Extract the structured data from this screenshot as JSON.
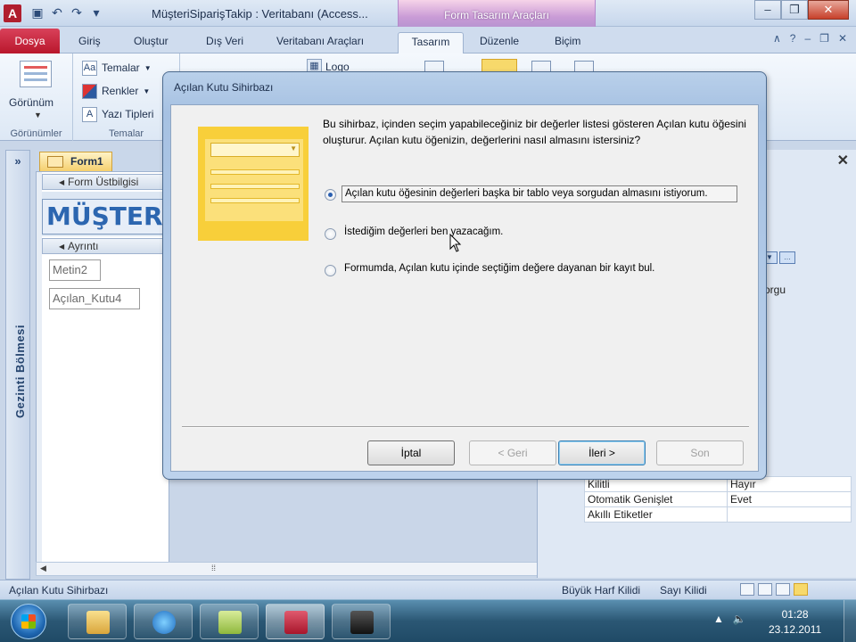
{
  "titlebar": {
    "app_letter": "A",
    "title": "MüşteriSiparişTakip : Veritabanı (Access...",
    "context_group": "Form Tasarım Araçları"
  },
  "tabs": [
    "Dosya",
    "Giriş",
    "Oluştur",
    "Dış Veri",
    "Veritabanı Araçları",
    "Tasarım",
    "Düzenle",
    "Biçim"
  ],
  "ribbon": {
    "view_label": "Görünüm",
    "views_group": "Görünümler",
    "themes_group": "Temalar",
    "themes": "Temalar",
    "colors": "Renkler",
    "fonts": "Yazı Tipleri",
    "logo": "Logo"
  },
  "nav_pane": {
    "label": "Gezinti Bölmesi",
    "toggle": "»"
  },
  "form": {
    "tab": "Form1",
    "header_section": "Form Üstbilgisi",
    "header_title": "MÜŞTERİ L",
    "detail_section": "Ayrıntı",
    "controls": [
      "Metin2",
      "Açılan_Kutu4"
    ]
  },
  "properties": {
    "partial_value": "orgu",
    "rows": [
      {
        "key": "Kilitli",
        "value": "Hayır"
      },
      {
        "key": "Otomatik Genişlet",
        "value": "Evet"
      },
      {
        "key": "Akıllı Etiketler",
        "value": ""
      }
    ]
  },
  "status": {
    "left": "Açılan Kutu Sihirbazı",
    "caps": "Büyük Harf Kilidi",
    "num": "Sayı Kilidi"
  },
  "taskbar": {
    "time": "01:28",
    "date": "23.12.2011"
  },
  "dialog": {
    "title": "Açılan Kutu Sihirbazı",
    "intro": "Bu sihirbaz, içinden seçim yapabileceğiniz bir değerler listesi gösteren Açılan kutu öğesini oluşturur. Açılan kutu öğenizin, değerlerini nasıl almasını istersiniz?",
    "options": [
      "Açılan kutu öğesinin değerleri başka bir tablo veya sorgudan almasını istiyorum.",
      "İstediğim değerleri ben yazacağım.",
      "Formumda, Açılan kutu içinde seçtiğim değere dayanan bir kayıt bul."
    ],
    "selected_option": 0,
    "buttons": {
      "cancel": "İptal",
      "back": "< Geri",
      "next": "İleri >",
      "finish": "Son"
    }
  }
}
